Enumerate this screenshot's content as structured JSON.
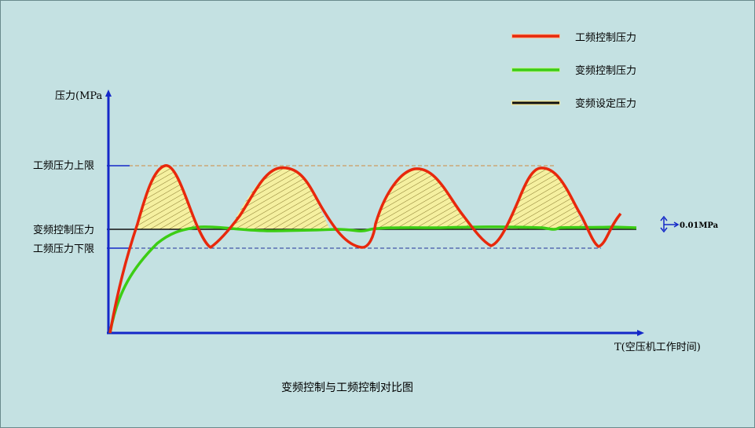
{
  "title": "变频控制与工频控制对比图",
  "y_axis_label": "压力(MPa",
  "x_axis_label": "T(空压机工作时间)",
  "levels": {
    "upper": "工频压力上限",
    "vfd_setpoint": "变频控制压力",
    "lower": "工频压力下限"
  },
  "precision_note": "0.01MPa",
  "legend": [
    {
      "label": "工频控制压力",
      "color": "#e8280c",
      "icon": "legend-line-red"
    },
    {
      "label": "变频控制压力",
      "color": "#3ccd14",
      "icon": "legend-line-green"
    },
    {
      "label": "变频设定压力",
      "color": "#111111",
      "icon": "legend-line-black"
    }
  ],
  "colors": {
    "background": "#c4e1e2",
    "axis": "#1428c8",
    "fill": "#f5f0a0",
    "hatch": "#7a6a20",
    "upper_line": "#d08a40",
    "lower_line": "#223399"
  }
}
